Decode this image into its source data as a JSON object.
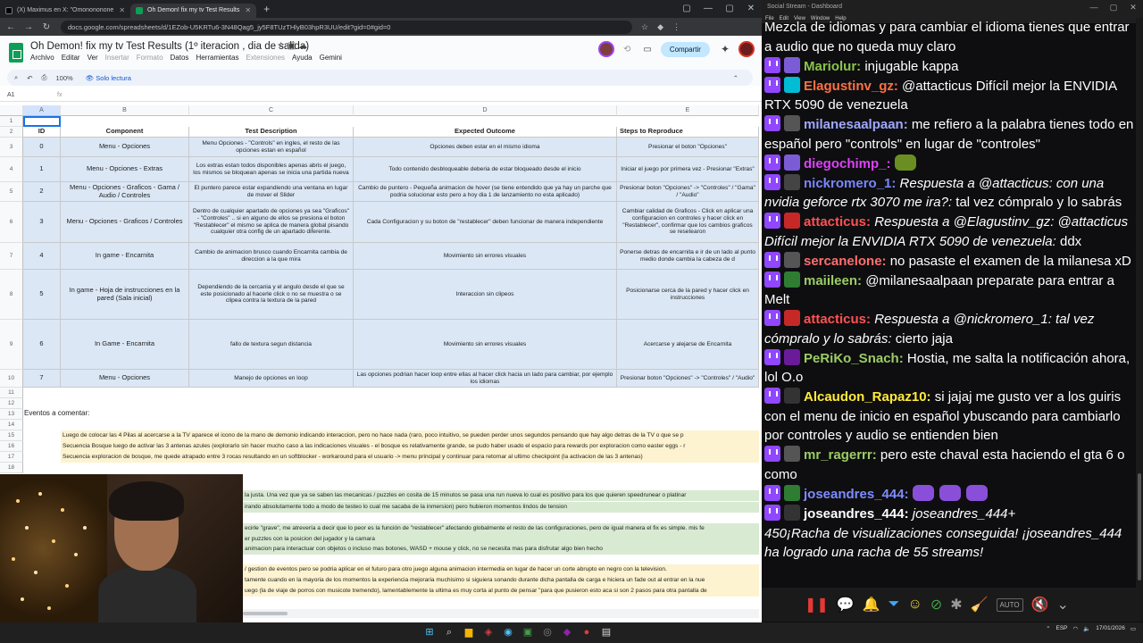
{
  "browser": {
    "tabs": [
      {
        "label": "(X) Maximus en X: \"Omonononone"
      },
      {
        "label": "Oh Demon! fix my tv Test Results"
      }
    ],
    "address": "docs.google.com/spreadsheets/d/1EZob-U5KRTu6-3N48Qag5_jy5F8TUzTHlyB03hpR3UU/edit?gid=0#gid=0"
  },
  "sheet": {
    "title": "Oh Demon! fix my tv Test Results (1º iteracion , dia de salida)",
    "menu": [
      "Archivo",
      "Editar",
      "Ver",
      "Insertar",
      "Formato",
      "Datos",
      "Herramientas",
      "Extensiones",
      "Ayuda",
      "Gemini"
    ],
    "menu_disabled": [
      false,
      false,
      false,
      true,
      true,
      false,
      false,
      true,
      false,
      false
    ],
    "share_label": "Compartir",
    "zoom": "100%",
    "readonly_label": "Solo lectura",
    "cell_ref": "A1",
    "fx": "fx",
    "columns": [
      "A",
      "B",
      "C",
      "D",
      "E"
    ],
    "rows": [
      "1",
      "2",
      "3",
      "4",
      "5",
      "6",
      "7",
      "8",
      "9",
      "10",
      "11",
      "12",
      "13",
      "14",
      "15",
      "16",
      "17",
      "18"
    ],
    "headers": [
      "ID",
      "Component",
      "Test Description",
      "Expected Outcome",
      "Steps to Reproduce"
    ],
    "table": [
      [
        "0",
        "Menu - Opciones",
        "Menu Opciones -  \"Controls\" en ingles, el resto de las opciones estan en español",
        "Opciones deben estar en el mismo idioma",
        "Presionar el boton \"Opciones\""
      ],
      [
        "1",
        "Menu - Opciones - Extras",
        "Los extras estan todos disponibles apenas abris el juego, los mismos se bloquean apenas se inicia una partida nueva",
        "Todo contenido desbloqueable  deberia de estar bloqueado desde el inicio",
        "Iniciar el juego por primera vez - Presionar \"Extras\""
      ],
      [
        "2",
        "Menu - Opciones - Graficos - Gama / Audio / Controles",
        "El puntero parece estar expandiendo una ventana en lugar de mover el Slider",
        "Cambio de puntero - Pequeña animacion de hover (se tiene entendido que ya hay un parche que podria solucionar esto pero a hoy dia 1 de lanzamiento no esta aplicado)",
        "Presionar boton \"Opciones\" -> \"Controles\" / \"Gama\" / \"Audio\""
      ],
      [
        "3",
        "Menu - Opciones - Graficos / Controles",
        "Dentro de cualquier apartado de opciones ya sea \"Graficos\" - \"Controles\" .. si en alguno de ellos se presiona el boton \"Restablecer\" el mismo se aplica de manera global pisando cualquier otra config de un apartado diferente.",
        "Cada Configuracion y su boton de \"restablecer\" deben funcionar de manera independiente",
        "Cambiar calidad de Graficos - Click en aplicar una configuracion en controles y hacer click en \"Restablecer\", confirmar que los cambios graficos se resetearon"
      ],
      [
        "4",
        "In game - Encarnita",
        "Cambio de animacion brusco cuando Encarnita cambia de direccion a la que mira",
        "Movimiento sin errores visuales",
        "Ponerse detras de encarnita e ir de un lado al punto medio donde cambia la cabeza de d"
      ],
      [
        "5",
        "In game - Hoja de instrucciones en la pared (Sala inicial)",
        "Dependiendo de la cercania y el angulo desde el que se este posicionado al hacerle click o no se muestra o se clipea contra la textura de la pared",
        "Interaccion sin clipeos",
        "Posicionarse cerca de la pared y hacer click en instrucciones"
      ],
      [
        "6",
        "In Game - Encarnita",
        "fallo de textura segun distancia",
        "Movimiento sin errores visuales",
        "Acercarse y alejarse de Encarnita"
      ],
      [
        "7",
        "Menu - Opciones",
        "Manejo de opciones en loop",
        "Las opciones podrian hacer loop entre ellas al hacer click hacia un lado para cambiar, por ejemplo los idiomas",
        "Presionar boton \"Opciones\" -> \"Controles\" / \"Audio\""
      ]
    ],
    "events_title": "Eventos a comentar:",
    "events_rows": [
      "13",
      "14",
      "15",
      "16",
      "17",
      "18"
    ],
    "events": [
      {
        "text": "Luego de colocar las 4 Pilas al acercarse a la TV aparece el icono de la mano de demonio indicando interaccion, pero no hace nada  (raro, poco intuitivo, se pueden perder unos segundos pensando que hay algo detras de la TV o que se p",
        "color": "yellow"
      },
      {
        "text": "Secuencia Bosque luego de activar las 3 antenas azules (explorarlo sin hacer mucho caso a las indicaciones visuales - el bosque es relativamente grande, se pudo haber usado el espacio para rewards por exploracion como easter eggs - r",
        "color": "yellow"
      },
      {
        "text": "Secuencia exploracion de bosque, me quede atrapado entre 3 rocas resultando en un  softblocker - workaround para el usuario -> menu principal y continuar para retornar al ultimo checkpoint (la activacion de las 3 antenas)",
        "color": "yellow"
      }
    ],
    "events_hidden": [
      {
        "text": "la justa. Una vez que ya se saben las mecanicas / puzzles  en cosita de 15 minutos se pasa una run nueva lo cual es positivo para los que quieren speedrunear o platinar",
        "color": "green"
      },
      {
        "text": "irando absolutamente todo a modo de testeo lo cual me sacaba de la inmersion) pero hubieron momentos lindos de tension",
        "color": "green"
      },
      {
        "text": "ecirle \"grave\", me atrevería a decir que lo peor es la función de \"restablecer\"  afectando globalmente el resto de las configuraciones, pero de igual manera el fix es simple. mis fe",
        "color": "green"
      },
      {
        "text": "er puzzles con la posicion del jugador y la camara",
        "color": "green"
      },
      {
        "text": "animacion para interactuar con objetos o incluso mas botones, WASD + mouse y click, no se necesita mas para disfrutar algo bien hecho",
        "color": "green"
      },
      {
        "text": "/ gestion de eventos pero se podria aplicar en el futuro para otro juego alguna animacion intermedia en lugar de hacer un corte abrupto en negro con la television.",
        "color": "yellow"
      },
      {
        "text": "tamente cuando en la mayoria de los momentos la experiencia mejoraria muchisimo si siguiera sonando durante dicha pantalla de carga e hiciera un fade out al entrar en la nue",
        "color": "yellow"
      },
      {
        "text": "uego (la de viaje de porros con musicote tremendo), lamentablemente la ultima es muy corta al punto de pensar \"para que pusieron esto aca si son 2 pasos para otra pantalla de",
        "color": "yellow"
      }
    ]
  },
  "stream": {
    "title": "Social Stream - Dashboard",
    "menu": [
      "File",
      "Edit",
      "View",
      "Window",
      "Help"
    ],
    "messages": [
      {
        "user": "",
        "text": "Mezcla de idiomas y para cambiar el idioma tienes que entrar a audio que no queda muy claro",
        "color": "#ffffff",
        "continuation": true
      },
      {
        "user": "Mariolur:",
        "text": "injugable kappa",
        "color": "#8bc34a",
        "badge": "#7b5cd6"
      },
      {
        "user": "Elagustinv_gz:",
        "text": "@attacticus Difícil mejor la ENVIDIA RTX 5090 de venezuela",
        "color": "#ff7043",
        "badge": "#00bcd4"
      },
      {
        "user": "milanesaalpaan:",
        "text": "me refiero a la palabra tienes todo en español pero \"controls\" en lugar de \"controles\"",
        "color": "#9fa8ff",
        "badge": "#555"
      },
      {
        "user": "diegochimp_:",
        "text": "",
        "color": "#e040fb",
        "badge": "#7b5cd6",
        "emote": true
      },
      {
        "user": "nickromero_1:",
        "reply": "Respuesta a @attacticus: con una nvidia geforce rtx 3070 me ira?:",
        "text": "tal vez cómpralo y lo sabrás",
        "color": "#7986ff",
        "badge": "#444"
      },
      {
        "user": "attacticus:",
        "reply": "Respuesta a @Elagustinv_gz: @attacticus Difícil mejor la ENVIDIA RTX 5090 de venezuela:",
        "text": "ddx",
        "color": "#ff5252",
        "badge": "#c62828"
      },
      {
        "user": "sercanelone:",
        "text": "no pasaste el examen de la milanesa xD",
        "color": "#ff6e6e",
        "badge": "#555"
      },
      {
        "user": "maiileen:",
        "text": "@milanesaalpaan preparate para entrar a Melt",
        "color": "#9ccc65",
        "badge": "#2e7d32"
      },
      {
        "user": "attacticus:",
        "reply": "Respuesta a @nickromero_1: tal vez cómpralo y lo sabrás:",
        "text": "cierto jaja",
        "color": "#ff5252",
        "badge": "#c62828"
      },
      {
        "user": "PeRiKo_Snach:",
        "text": "Hostia, me salta la notificación ahora, lol O.o",
        "color": "#9ccc65",
        "badge": "#6a1b9a"
      },
      {
        "user": "Alcaudon_Rapaz10:",
        "text": "si jajaj me gusto ver a los guiris con el menu de inicio en español ybuscando para cambiarlo por controles y audio se entienden bien",
        "color": "#ffeb3b",
        "badge": "#333"
      },
      {
        "user": "mr_ragerrr:",
        "text": "pero este chaval esta haciendo el gta 6 o como",
        "color": "#9ccc65",
        "badge": "#555"
      },
      {
        "user": "joseandres_444:",
        "text": "",
        "color": "#7e8cff",
        "badge": "#2e7d32",
        "emotes": 3
      },
      {
        "user": "joseandres_444:",
        "reply": "joseandres_444+",
        "text": "",
        "color": "#ffffff",
        "badge": "#333"
      },
      {
        "user": "",
        "text": "450¡Racha de visualizaciones conseguida! ¡joseandres_444 ha logrado una racha de 55 streams!",
        "color": "#ffffff",
        "italic": true,
        "continuation": true
      }
    ],
    "toolbar_auto": "AUTO"
  },
  "taskbar": {
    "lang": "ESP",
    "time": "",
    "date": "17/01/2026"
  }
}
